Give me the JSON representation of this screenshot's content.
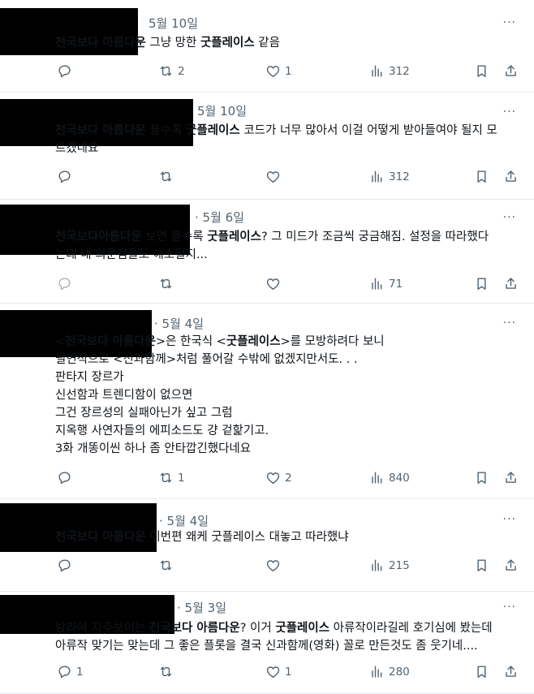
{
  "tweets": [
    {
      "date": "5월 10일",
      "lines": [
        [
          {
            "t": "천국보다 아름다운",
            "b": true
          },
          {
            "t": " 그냥 망한 "
          },
          {
            "t": "굿플레이스",
            "b": true
          },
          {
            "t": " 같음"
          }
        ]
      ],
      "reply": "",
      "retweet": "2",
      "like": "1",
      "views": "312"
    },
    {
      "date": "5월 10일",
      "lines": [
        [
          {
            "t": "천국보다 아름다운",
            "b": true
          },
          {
            "t": " 볼수록 "
          },
          {
            "t": "굿플레이스",
            "b": true
          },
          {
            "t": " 코드가 너무 많아서 이걸 어떻게 받아들여야 될지 모"
          }
        ],
        [
          {
            "t": "르겠네요"
          }
        ]
      ],
      "reply": "",
      "retweet": "",
      "like": "",
      "views": "312"
    },
    {
      "date": "· 5월 6일",
      "lines": [
        [
          {
            "t": "천국보다아름다운",
            "b": true
          },
          {
            "t": " 보면 볼수록 "
          },
          {
            "t": "굿플레이스",
            "b": true
          },
          {
            "t": "? 그 미드가 조금씩 궁금해짐. 설정을 따라했다"
          }
        ],
        [
          {
            "t": "는데 내 의문점들도 해소될지..."
          }
        ]
      ],
      "reply": "",
      "retweet": "",
      "like": "",
      "views": "71"
    },
    {
      "date": "· 5월 4일",
      "lines": [
        [
          {
            "t": "<"
          },
          {
            "t": "천국보다 아름다운",
            "b": true
          },
          {
            "t": ">은 한국식 <"
          },
          {
            "t": "굿플레이스",
            "b": true
          },
          {
            "t": ">를 모방하려다 보니"
          }
        ],
        [
          {
            "t": "필연적으로 <신과함께>처럼 풀어갈 수밖에 없겠지만서도. . ."
          }
        ],
        [
          {
            "t": "판타지 장르가"
          }
        ],
        [
          {
            "t": "신선함과 트렌디함이 없으면"
          }
        ],
        [
          {
            "t": "그건 장르성의 실패아닌가 싶고 그럼"
          }
        ],
        [
          {
            "t": "지옥행 사연자들의 에피소드도 걍 겉핥기고."
          }
        ],
        [
          {
            "t": "3화 개똥이씬 하나 좀 안타깝긴했다네요"
          }
        ]
      ],
      "reply": "",
      "retweet": "1",
      "like": "2",
      "views": "840"
    },
    {
      "date": "· 5월 4일",
      "lines": [
        [
          {
            "t": "천국보다 아름다운",
            "b": true
          },
          {
            "t": " 이번편 왜케 굿플레이스 대놓고 따라했냐"
          }
        ]
      ],
      "reply": "",
      "retweet": "",
      "like": "",
      "views": "215"
    },
    {
      "date": "· 5월 3일",
      "lines": [
        [
          {
            "t": "탐라에 자주보이는 "
          },
          {
            "t": "천국보다 아름다운",
            "b": true
          },
          {
            "t": "? 이거 "
          },
          {
            "t": "굿플레이스",
            "b": true
          },
          {
            "t": " 아류작이라길레 호기심에 봤는데"
          }
        ],
        [
          {
            "t": "아류작 맞기는 맞는데 그 좋은 플롯을 결국 신과함께(영화) 꼴로 만든것도 좀 웃기네...."
          }
        ]
      ],
      "reply": "1",
      "retweet": "",
      "like": "1",
      "views": "280"
    }
  ]
}
